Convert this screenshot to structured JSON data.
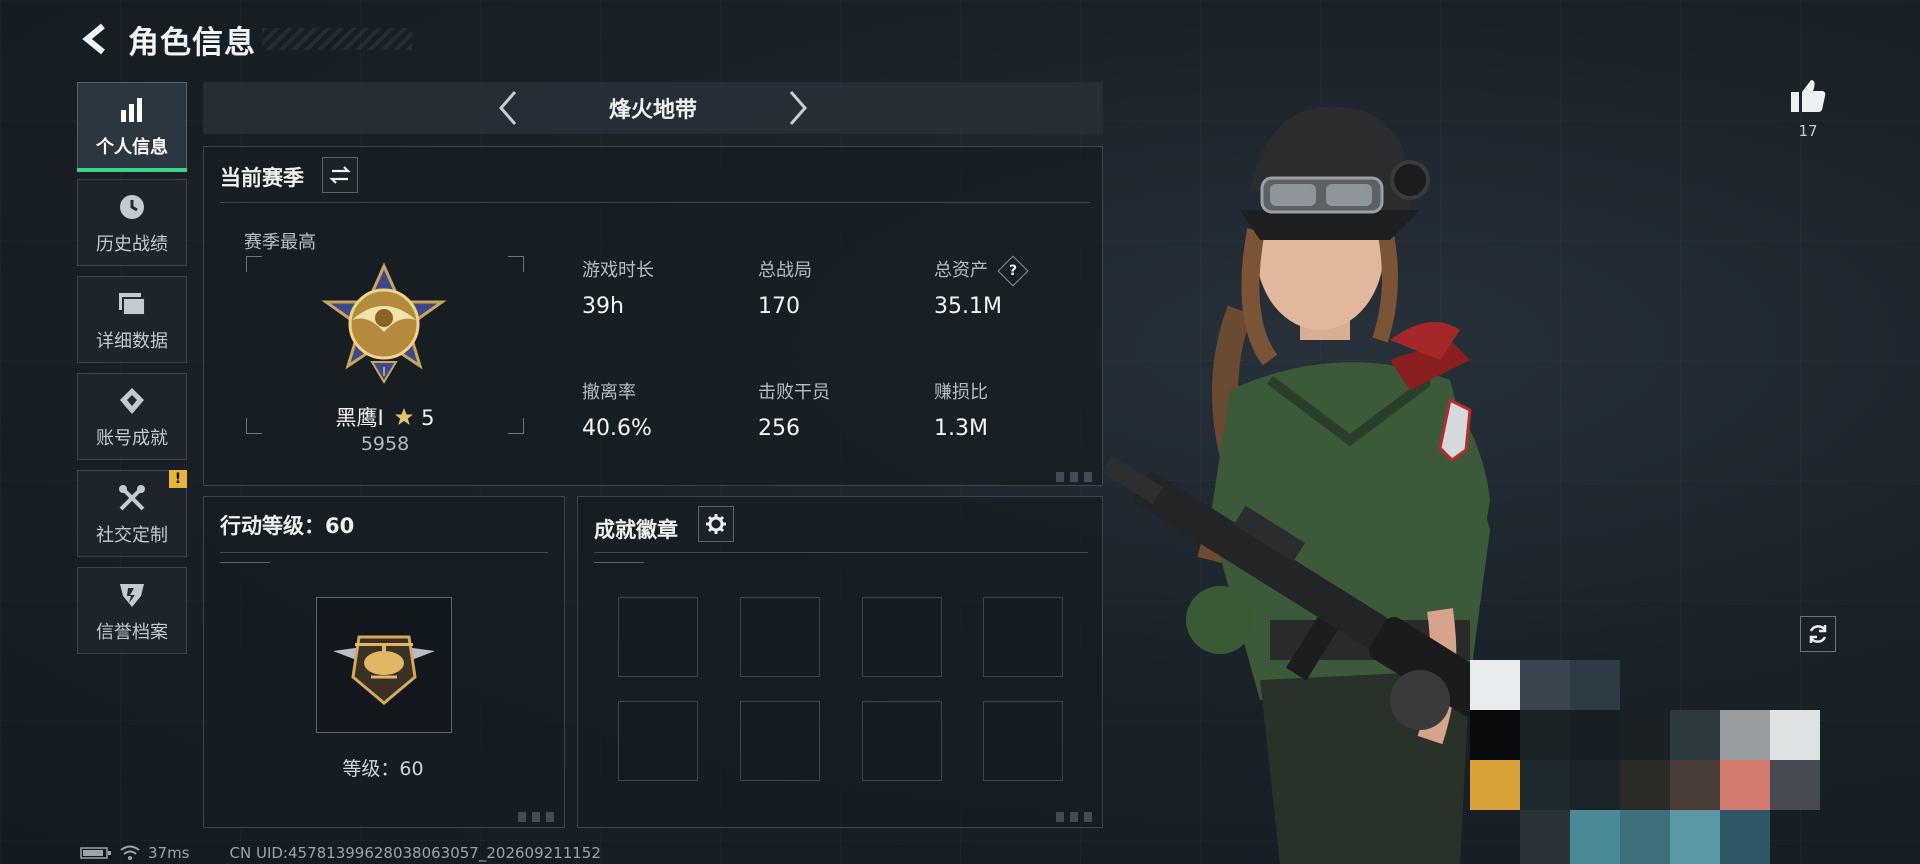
{
  "header": {
    "title": "角色信息"
  },
  "sidebar": {
    "items": [
      {
        "label": "个人信息",
        "icon": "bar-chart-icon",
        "active": true
      },
      {
        "label": "历史战绩",
        "icon": "clock-icon"
      },
      {
        "label": "详细数据",
        "icon": "folder-icon"
      },
      {
        "label": "账号成就",
        "icon": "achievement-icon"
      },
      {
        "label": "社交定制",
        "icon": "tools-icon",
        "alert": "!"
      },
      {
        "label": "信誉档案",
        "icon": "credit-icon"
      }
    ]
  },
  "mode": {
    "name": "烽火地带"
  },
  "season": {
    "title": "当前赛季",
    "best_label": "赛季最高",
    "rank_name": "黑鹰I",
    "rank_stars": "5",
    "rank_score": "5958",
    "stats": [
      {
        "label": "游戏时长",
        "value": "39h"
      },
      {
        "label": "总战局",
        "value": "170"
      },
      {
        "label": "总资产",
        "value": "35.1M",
        "help": "?"
      },
      {
        "label": "撤离率",
        "value": "40.6%"
      },
      {
        "label": "击败干员",
        "value": "256"
      },
      {
        "label": "赚损比",
        "value": "1.3M"
      }
    ]
  },
  "action_level": {
    "title": "行动等级：60",
    "level_text": "等级：60"
  },
  "badges": {
    "title": "成就徽章"
  },
  "like": {
    "count": "17"
  },
  "footer": {
    "ping": "37ms",
    "uid": "CN UID:45781399628038063057_202609211152"
  },
  "colors": {
    "accent": "#3fd28a",
    "alert": "#e8b53a"
  }
}
